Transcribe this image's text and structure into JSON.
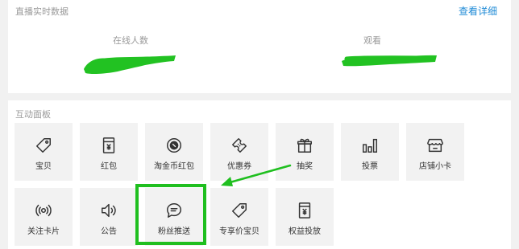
{
  "live_data": {
    "title": "直播实时数据",
    "detail_link": "查看详细",
    "stats": [
      {
        "label": "在线人数"
      },
      {
        "label": "观看"
      }
    ]
  },
  "interactive_panel": {
    "title": "互动面板",
    "tiles_row1": [
      {
        "label": "宝贝",
        "icon": "tag-icon"
      },
      {
        "label": "红包",
        "icon": "red-envelope-icon"
      },
      {
        "label": "淘金币红包",
        "icon": "coin-icon"
      },
      {
        "label": "优惠券",
        "icon": "coupon-icon"
      },
      {
        "label": "抽奖",
        "icon": "gift-icon"
      },
      {
        "label": "投票",
        "icon": "bar-chart-icon"
      },
      {
        "label": "店铺小卡",
        "icon": "shop-icon"
      }
    ],
    "tiles_row2": [
      {
        "label": "关注卡片",
        "icon": "broadcast-icon"
      },
      {
        "label": "公告",
        "icon": "speaker-icon"
      },
      {
        "label": "粉丝推送",
        "icon": "message-bubble-icon"
      },
      {
        "label": "专享价宝贝",
        "icon": "tag-icon"
      },
      {
        "label": "权益投放",
        "icon": "voucher-icon"
      }
    ]
  },
  "annotations": {
    "highlight_color": "#1fbf1f",
    "highlighted_tile": "粉丝推送"
  },
  "colors": {
    "link": "#1e8ad6",
    "muted_text": "#999999",
    "tile_bg": "#f2f2f2",
    "page_bg": "#f1f1f1"
  }
}
